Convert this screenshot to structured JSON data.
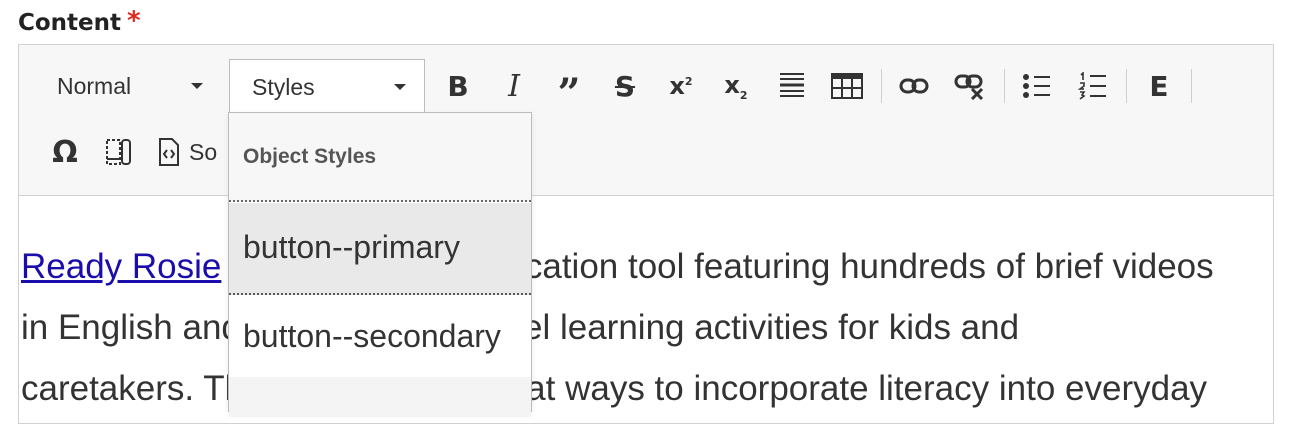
{
  "field": {
    "label": "Content",
    "required_mark": "*"
  },
  "toolbar": {
    "format_value": "Normal",
    "styles_value": "Styles",
    "source_label": "So",
    "accent_color": "#e02b20"
  },
  "styles_dropdown": {
    "group_title": "Object Styles",
    "items": [
      "button--primary",
      "button--secondary",
      ""
    ]
  },
  "content": {
    "link_text": "Ready Rosie",
    "line1_rest": "is a free family education tool featuring hundreds of brief videos",
    "line2": "in English and Spanish that model learning activities for kids and",
    "line3": "caretakers. The videos show great ways to incorporate literacy into everyday"
  }
}
